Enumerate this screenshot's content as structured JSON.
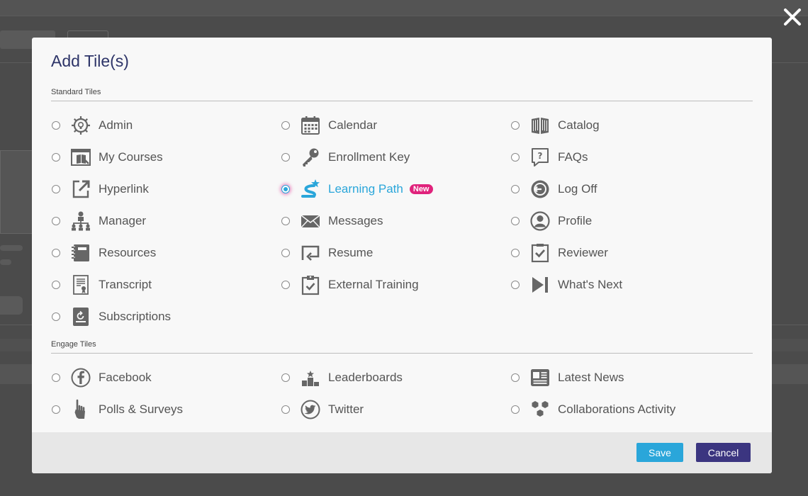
{
  "dialog": {
    "title": "Add Tile(s)",
    "close_icon": "close-icon"
  },
  "sections": [
    {
      "heading": "Standard Tiles",
      "tiles": [
        {
          "label": "Admin",
          "icon": "admin-gear-icon",
          "selected": false
        },
        {
          "label": "Calendar",
          "icon": "calendar-icon",
          "selected": false
        },
        {
          "label": "Catalog",
          "icon": "book-icon",
          "selected": false
        },
        {
          "label": "My Courses",
          "icon": "my-courses-icon",
          "selected": false
        },
        {
          "label": "Enrollment Key",
          "icon": "key-icon",
          "selected": false
        },
        {
          "label": "FAQs",
          "icon": "faq-icon",
          "selected": false
        },
        {
          "label": "Hyperlink",
          "icon": "external-link-icon",
          "selected": false
        },
        {
          "label": "Learning Path",
          "icon": "learning-path-icon",
          "selected": true,
          "badge": "New"
        },
        {
          "label": "Log Off",
          "icon": "log-off-icon",
          "selected": false
        },
        {
          "label": "Manager",
          "icon": "org-chart-icon",
          "selected": false
        },
        {
          "label": "Messages",
          "icon": "envelope-icon",
          "selected": false
        },
        {
          "label": "Profile",
          "icon": "profile-icon",
          "selected": false
        },
        {
          "label": "Resources",
          "icon": "notebook-icon",
          "selected": false
        },
        {
          "label": "Resume",
          "icon": "resume-icon",
          "selected": false
        },
        {
          "label": "Reviewer",
          "icon": "reviewer-check-icon",
          "selected": false
        },
        {
          "label": "Transcript",
          "icon": "certificate-icon",
          "selected": false
        },
        {
          "label": "External Training",
          "icon": "clipboard-check-icon",
          "selected": false
        },
        {
          "label": "What's Next",
          "icon": "next-track-icon",
          "selected": false
        },
        {
          "label": "Subscriptions",
          "icon": "subscription-icon",
          "selected": false
        }
      ]
    },
    {
      "heading": "Engage Tiles",
      "tiles": [
        {
          "label": "Facebook",
          "icon": "facebook-icon",
          "selected": false
        },
        {
          "label": "Leaderboards",
          "icon": "leaderboard-icon",
          "selected": false
        },
        {
          "label": "Latest News",
          "icon": "news-icon",
          "selected": false
        },
        {
          "label": "Polls & Surveys",
          "icon": "poll-hand-icon",
          "selected": false
        },
        {
          "label": "Twitter",
          "icon": "twitter-icon",
          "selected": false
        },
        {
          "label": "Collaborations Activity",
          "icon": "collaboration-hex-icon",
          "selected": false
        }
      ]
    }
  ],
  "footer": {
    "save_label": "Save",
    "cancel_label": "Cancel"
  },
  "colors": {
    "accent": "#2aa6da",
    "cancel": "#3b3580",
    "badge": "#e0237c",
    "title": "#2d3468",
    "icon": "#666666"
  }
}
